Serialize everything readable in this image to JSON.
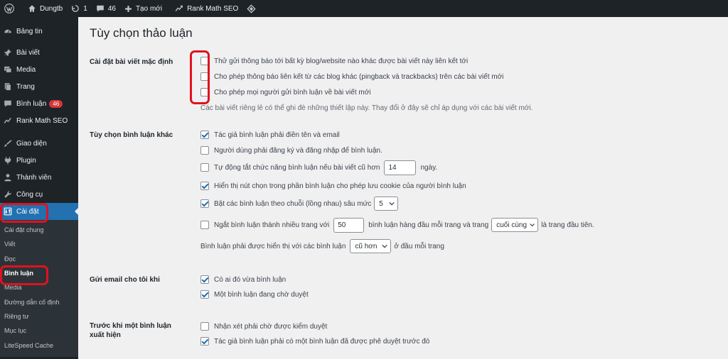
{
  "adminbar": {
    "site_name": "Dungtb",
    "updates_count": "1",
    "comments_count": "46",
    "new_label": "Tạo mới",
    "rankmath_label": "Rank Math SEO"
  },
  "sidebar": {
    "items": [
      {
        "label": "Bảng tin",
        "icon": "dashboard-icon"
      },
      {
        "label": "Bài viết",
        "icon": "pin-icon"
      },
      {
        "label": "Media",
        "icon": "media-icon"
      },
      {
        "label": "Trang",
        "icon": "page-icon"
      },
      {
        "label": "Bình luận",
        "icon": "comment-icon",
        "badge": "46"
      },
      {
        "label": "Rank Math SEO",
        "icon": "rankmath-icon"
      },
      {
        "label": "Giao diện",
        "icon": "brush-icon"
      },
      {
        "label": "Plugin",
        "icon": "plugin-icon"
      },
      {
        "label": "Thành viên",
        "icon": "user-icon"
      },
      {
        "label": "Công cụ",
        "icon": "wrench-icon"
      },
      {
        "label": "Cài đặt",
        "icon": "settings-icon"
      }
    ],
    "submenu": [
      "Cài đặt chung",
      "Viết",
      "Đọc",
      "Bình luận",
      "Media",
      "Đường dẫn cố định",
      "Riêng tư",
      "Mục lục",
      "LiteSpeed Cache"
    ]
  },
  "main": {
    "title": "Tùy chọn thảo luận",
    "default_post": {
      "label": "Cài đặt bài viết mặc định",
      "options": [
        "Thử gửi thông báo tới bất kỳ blog/website nào khác được bài viết này liên kết tới",
        "Cho phép thông báo liên kết từ các blog khác (pingback và trackbacks) trên các bài viết mới",
        "Cho phép mọi người gửi bình luận về bài viết mới"
      ],
      "description": "Các bài viết riêng lẻ có thể ghi đè những thiết lập này. Thay đổi ở đây sẽ chỉ áp dụng với các bài viết mới."
    },
    "other_comments": {
      "label": "Tùy chọn bình luận khác",
      "opt1": "Tác giả bình luận phải điền tên và email",
      "opt2": "Người dùng phải đăng ký và đăng nhập để bình luận.",
      "opt3_before": "Tự động tắt chức năng bình luận nếu bài viết cũ hơn",
      "opt3_value": "14",
      "opt3_after": "ngày.",
      "opt4": "Hiển thị nút chọn trong phần bình luận cho phép lưu cookie của người bình luận",
      "opt5_before": "Bật các bình luận theo chuỗi (lồng nhau) sâu mức",
      "opt5_value": "5",
      "opt6_before": "Ngắt bình luận thành nhiều trang với",
      "opt6_value": "50",
      "opt6_middle": "bình luận hàng đầu mỗi trang và trang",
      "opt6_select": "cuối cùng",
      "opt6_after": "là trang đầu tiên.",
      "opt7_before": "Bình luận phải được hiển thị với các bình luận",
      "opt7_select": "cũ hơn",
      "opt7_after": "ở đầu mỗi trang"
    },
    "email_me": {
      "label": "Gửi email cho tôi khi",
      "opt1": "Có ai đó vừa bình luận",
      "opt2": "Một bình luận đang chờ duyệt"
    },
    "before_appear": {
      "label": "Trước khi một bình luận xuất hiện",
      "opt1": "Nhận xét phải chờ được kiểm duyệt",
      "opt2": "Tác giả bình luận phải có một bình luận đã được phê duyệt trước đó"
    }
  }
}
